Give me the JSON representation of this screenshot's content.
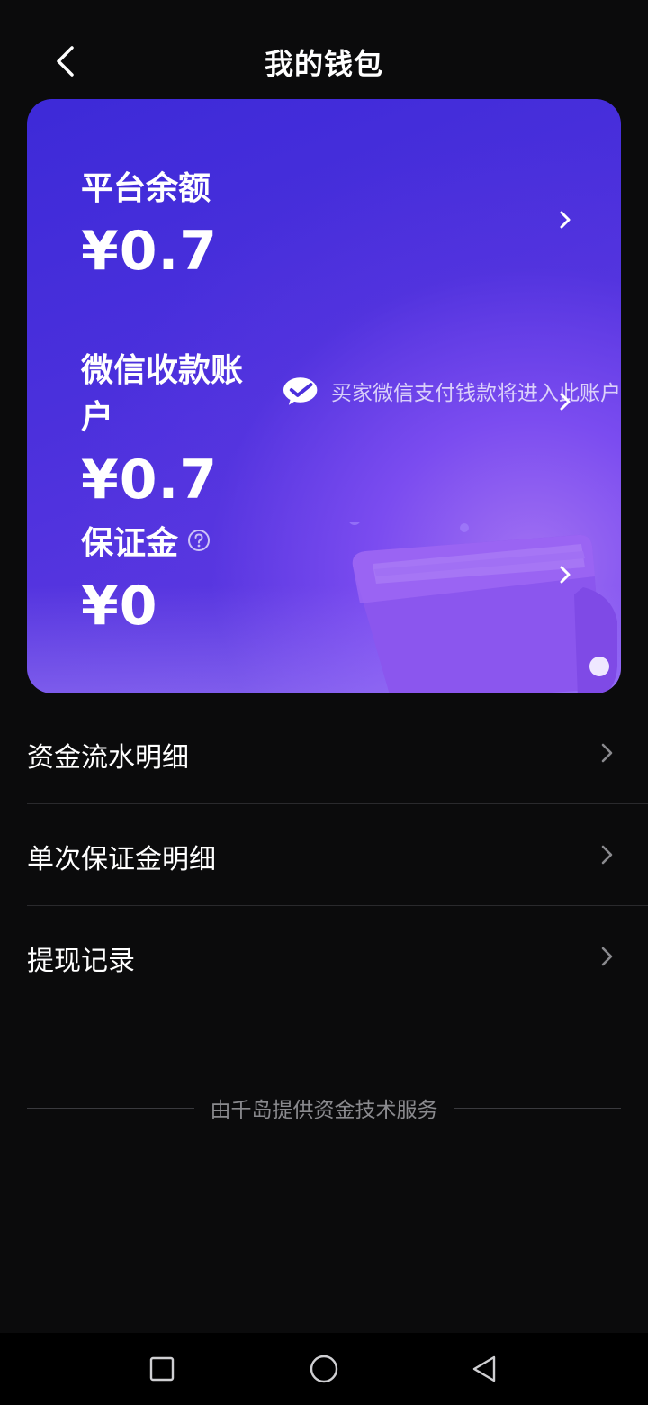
{
  "header": {
    "title": "我的钱包",
    "back_icon": "chevron-left-icon"
  },
  "wallet_card": {
    "platform_balance": {
      "label": "平台余额",
      "amount": "¥0.7"
    },
    "wechat_account": {
      "label": "微信收款账户",
      "icon": "wechat-pay-icon",
      "note": "买家微信支付钱款将进入此账户",
      "amount": "¥0.7"
    },
    "deposit": {
      "label": "保证金",
      "help_icon": "question-circle-icon",
      "amount": "¥0"
    },
    "colors": {
      "gradient_start": "#3d2ad8",
      "gradient_end": "#6a3fe6"
    }
  },
  "menu": {
    "items": [
      {
        "label": "资金流水明细"
      },
      {
        "label": "单次保证金明细"
      },
      {
        "label": "提现记录"
      }
    ]
  },
  "footer": {
    "text": "由千岛提供资金技术服务"
  },
  "navbar": {
    "recent_icon": "square-icon",
    "home_icon": "circle-icon",
    "back_icon": "triangle-back-icon"
  }
}
